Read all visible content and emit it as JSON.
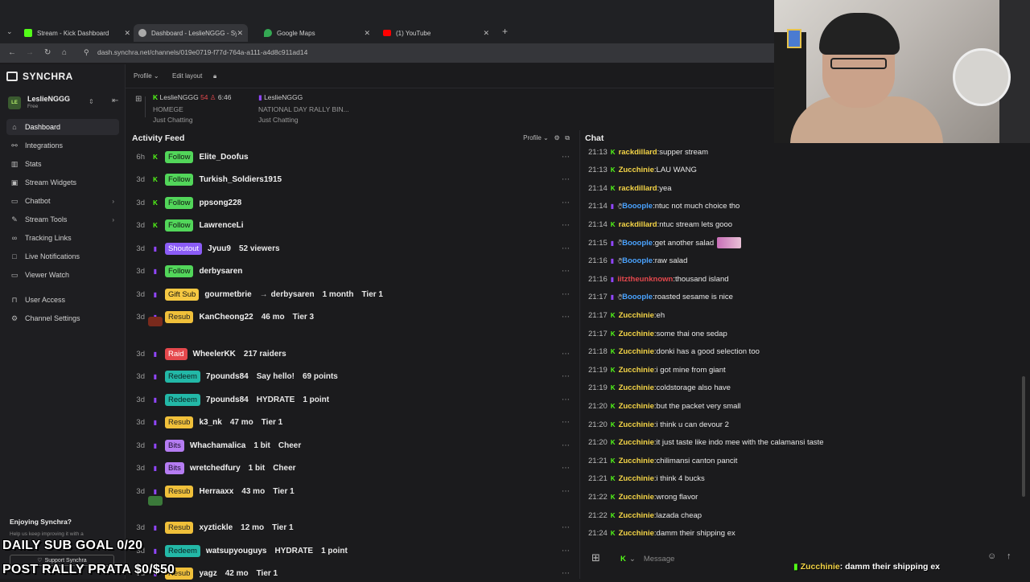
{
  "browser": {
    "tabs": [
      {
        "label": "Stream - Kick Dashboard",
        "favicon_color": "#53fc18"
      },
      {
        "label": "Dashboard - LeslieNGGG - Sync",
        "favicon_color": "#aaaaaa"
      },
      {
        "label": "Google Maps",
        "favicon_color": "#34a853"
      },
      {
        "label": "(1) YouTube",
        "favicon_color": "#ff0000"
      }
    ],
    "url": "dash.synchra.net/channels/019e0719-f77d-764a-a111-a4d8c911ad14"
  },
  "app": {
    "brand": "SYNCHRA",
    "user": {
      "initials": "LE",
      "name": "LeslieNGGG",
      "plan": "Free"
    },
    "topbar": {
      "profile": "Profile",
      "edit_layout": "Edit layout"
    },
    "nav": [
      {
        "label": "Dashboard",
        "icon": "home-icon",
        "active": true
      },
      {
        "label": "Integrations",
        "icon": "plug-icon"
      },
      {
        "label": "Stats",
        "icon": "bar-chart-icon"
      },
      {
        "label": "Stream Widgets",
        "icon": "widget-icon"
      },
      {
        "label": "Chatbot",
        "icon": "chat-icon",
        "chevron": true
      },
      {
        "label": "Stream Tools",
        "icon": "tools-icon",
        "chevron": true
      },
      {
        "label": "Tracking Links",
        "icon": "link-icon"
      },
      {
        "label": "Live Notifications",
        "icon": "bell-icon"
      },
      {
        "label": "Viewer Watch",
        "icon": "eye-icon"
      },
      {
        "label": "User Access",
        "icon": "lock-icon"
      },
      {
        "label": "Channel Settings",
        "icon": "gear-icon"
      }
    ],
    "streams": [
      {
        "channel": "LeslieNGGG",
        "viewers": "54",
        "time": "6:46",
        "title": "HOMEGE",
        "category": "Just Chatting"
      },
      {
        "channel": "LeslieNGGG",
        "title": "NATIONAL DAY RALLY BIN...",
        "category": "Just Chatting"
      }
    ],
    "promo": {
      "title": "Enjoying Synchra?",
      "text": "Help us keep improving it with a",
      "button": "Support Synchra"
    }
  },
  "feed": {
    "title": "Activity Feed",
    "profile": "Profile",
    "rows": [
      {
        "age": "6h",
        "platform": "kick",
        "type": "Follow",
        "user": "Elite_Doofus"
      },
      {
        "age": "3d",
        "platform": "kick",
        "type": "Follow",
        "user": "Turkish_Soldiers1915"
      },
      {
        "age": "3d",
        "platform": "kick",
        "type": "Follow",
        "user": "ppsong228"
      },
      {
        "age": "3d",
        "platform": "kick",
        "type": "Follow",
        "user": "LawrenceLi"
      },
      {
        "age": "3d",
        "platform": "twitch",
        "type": "Shoutout",
        "user": "Jyuu9",
        "d1": "52 viewers"
      },
      {
        "age": "3d",
        "platform": "twitch",
        "type": "Follow",
        "user": "derbysaren"
      },
      {
        "age": "3d",
        "platform": "twitch",
        "type": "Gift Sub",
        "user": "gourmetbrie",
        "d1": "derbysaren",
        "d2": "1 month",
        "d3": "Tier 1"
      },
      {
        "age": "3d",
        "platform": "twitch",
        "type": "Resub",
        "user": "KanCheong22",
        "d1": "46 mo",
        "d2": "Tier 3"
      },
      {
        "age": "3d",
        "platform": "twitch",
        "type": "Raid",
        "user": "WheelerKK",
        "d1": "217 raiders"
      },
      {
        "age": "3d",
        "platform": "twitch",
        "type": "Redeem",
        "user": "7pounds84",
        "d1": "Say hello!",
        "d2": "69 points"
      },
      {
        "age": "3d",
        "platform": "twitch",
        "type": "Redeem",
        "user": "7pounds84",
        "d1": "HYDRATE",
        "d2": "1 point"
      },
      {
        "age": "3d",
        "platform": "twitch",
        "type": "Resub",
        "user": "k3_nk",
        "d1": "47 mo",
        "d2": "Tier 1"
      },
      {
        "age": "3d",
        "platform": "twitch",
        "type": "Bits",
        "user": "Whachamalica",
        "d1": "1 bit",
        "d2": "Cheer"
      },
      {
        "age": "3d",
        "platform": "twitch",
        "type": "Bits",
        "user": "wretchedfury",
        "d1": "1 bit",
        "d2": "Cheer"
      },
      {
        "age": "3d",
        "platform": "twitch",
        "type": "Resub",
        "user": "Herraaxx",
        "d1": "43 mo",
        "d2": "Tier 1"
      },
      {
        "age": "3d",
        "platform": "twitch",
        "type": "Resub",
        "user": "xyztickle",
        "d1": "12 mo",
        "d2": "Tier 1"
      },
      {
        "age": "3d",
        "platform": "twitch",
        "type": "Redeem",
        "user": "watsupyouguys",
        "d1": "HYDRATE",
        "d2": "1 point"
      },
      {
        "age": "3d",
        "platform": "twitch",
        "type": "Resub",
        "user": "yagz",
        "d1": "42 mo",
        "d2": "Tier 1"
      }
    ]
  },
  "chat": {
    "title": "Chat",
    "input_placeholder": "Message",
    "messages": [
      {
        "ts": "21:13",
        "platform": "kick",
        "user": "rackdillard",
        "color": "#f5d547",
        "text": "supper stream"
      },
      {
        "ts": "21:13",
        "platform": "kick",
        "user": "Zucchinie",
        "color": "#f5d547",
        "text": "LAU WANG"
      },
      {
        "ts": "21:14",
        "platform": "kick",
        "user": "rackdillard",
        "color": "#f5d547",
        "text": "yea"
      },
      {
        "ts": "21:14",
        "platform": "twitch",
        "user": "Booople",
        "color": "#4aa3ff",
        "text": "ntuc not much choice tho"
      },
      {
        "ts": "21:14",
        "platform": "kick",
        "user": "rackdillard",
        "color": "#f5d547",
        "text": "ntuc stream lets gooo"
      },
      {
        "ts": "21:15",
        "platform": "twitch",
        "user": "Booople",
        "color": "#4aa3ff",
        "text": "get another salad"
      },
      {
        "ts": "21:16",
        "platform": "twitch",
        "user": "Booople",
        "color": "#4aa3ff",
        "text": "raw salad"
      },
      {
        "ts": "21:16",
        "platform": "twitch",
        "user": "iitztheunknown",
        "color": "#e5484d",
        "text": "thousand island"
      },
      {
        "ts": "21:17",
        "platform": "twitch",
        "user": "Booople",
        "color": "#4aa3ff",
        "text": "roasted sesame is nice"
      },
      {
        "ts": "21:17",
        "platform": "kick",
        "user": "Zucchinie",
        "color": "#f5d547",
        "text": "eh"
      },
      {
        "ts": "21:17",
        "platform": "kick",
        "user": "Zucchinie",
        "color": "#f5d547",
        "text": "some thai one sedap"
      },
      {
        "ts": "21:18",
        "platform": "kick",
        "user": "Zucchinie",
        "color": "#f5d547",
        "text": "donki has a good selection too"
      },
      {
        "ts": "21:19",
        "platform": "kick",
        "user": "Zucchinie",
        "color": "#f5d547",
        "text": "i got mine from giant"
      },
      {
        "ts": "21:19",
        "platform": "kick",
        "user": "Zucchinie",
        "color": "#f5d547",
        "text": "coldstorage also have"
      },
      {
        "ts": "21:20",
        "platform": "kick",
        "user": "Zucchinie",
        "color": "#f5d547",
        "text": "but the packet very small"
      },
      {
        "ts": "21:20",
        "platform": "kick",
        "user": "Zucchinie",
        "color": "#f5d547",
        "text": "i think u can devour 2"
      },
      {
        "ts": "21:20",
        "platform": "kick",
        "user": "Zucchinie",
        "color": "#f5d547",
        "text": "it just taste like indo mee with the calamansi taste"
      },
      {
        "ts": "21:21",
        "platform": "kick",
        "user": "Zucchinie",
        "color": "#f5d547",
        "text": "chilimansi canton pancit"
      },
      {
        "ts": "21:21",
        "platform": "kick",
        "user": "Zucchinie",
        "color": "#f5d547",
        "text": "i think 4 bucks"
      },
      {
        "ts": "21:22",
        "platform": "kick",
        "user": "Zucchinie",
        "color": "#f5d547",
        "text": "wrong flavor"
      },
      {
        "ts": "21:22",
        "platform": "kick",
        "user": "Zucchinie",
        "color": "#f5d547",
        "text": "lazada cheap"
      },
      {
        "ts": "21:24",
        "platform": "kick",
        "user": "Zucchinie",
        "color": "#f5d547",
        "text": "damm their shipping ex"
      }
    ]
  },
  "overlays": {
    "sub_goal": "DAILY SUB GOAL 0/20",
    "prata": "POST RALLY PRATA $0/$50",
    "last_chat_user": "Zucchinie",
    "last_chat_text": "damm their shipping ex"
  }
}
